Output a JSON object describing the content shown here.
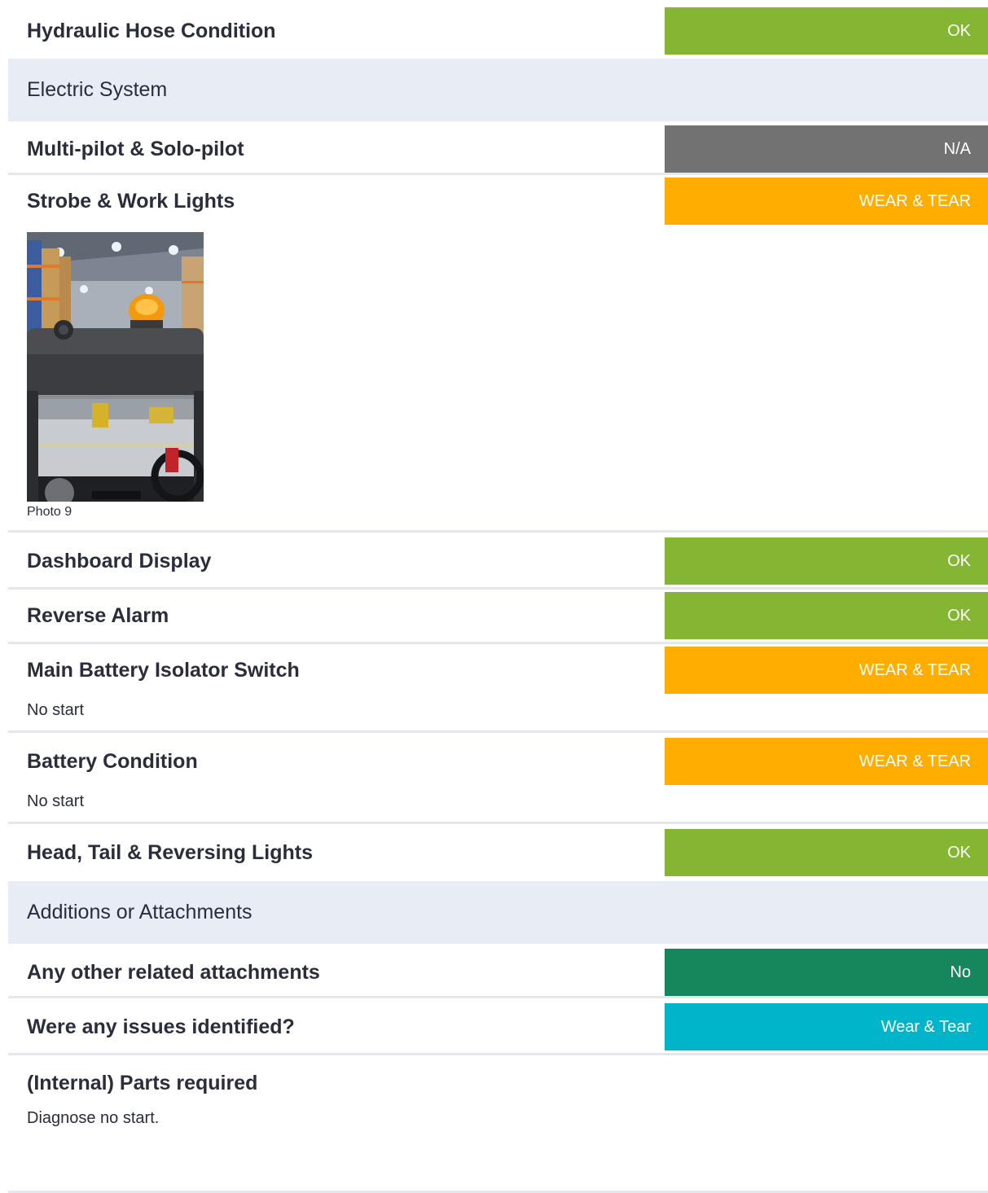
{
  "rows_top": {
    "hydraulic": {
      "label": "Hydraulic Hose Condition",
      "status": "OK",
      "color": "#84b634"
    },
    "section_electric": "Electric System",
    "multi_pilot": {
      "label": "Multi-pilot & Solo-pilot",
      "status": "N/A",
      "color": "#727272"
    },
    "strobe": {
      "label": "Strobe & Work Lights",
      "status": "WEAR & TEAR",
      "color": "#ffae00"
    },
    "photo_caption": "Photo 9"
  },
  "rows_mid": {
    "dashboard": {
      "label": "Dashboard Display",
      "status": "OK",
      "color": "#84b634"
    },
    "reverse_alarm": {
      "label": "Reverse Alarm",
      "status": "OK",
      "color": "#84b634"
    },
    "isolator": {
      "label": "Main Battery Isolator Switch",
      "status": "WEAR & TEAR",
      "color": "#ffae00",
      "note": "No start"
    },
    "battery": {
      "label": "Battery Condition",
      "status": "WEAR & TEAR",
      "color": "#ffae00",
      "note": "No start"
    },
    "lights": {
      "label": "Head, Tail & Reversing Lights",
      "status": "OK",
      "color": "#84b634"
    }
  },
  "rows_bottom": {
    "section_additions": "Additions or Attachments",
    "attachments": {
      "label": "Any other related attachments",
      "status": "No",
      "color": "#16865c"
    },
    "issues": {
      "label": "Were any issues identified?",
      "status": "Wear & Tear",
      "color": "#00b5c9"
    },
    "parts": {
      "label": "(Internal) Parts required",
      "note": "Diagnose no start."
    }
  }
}
